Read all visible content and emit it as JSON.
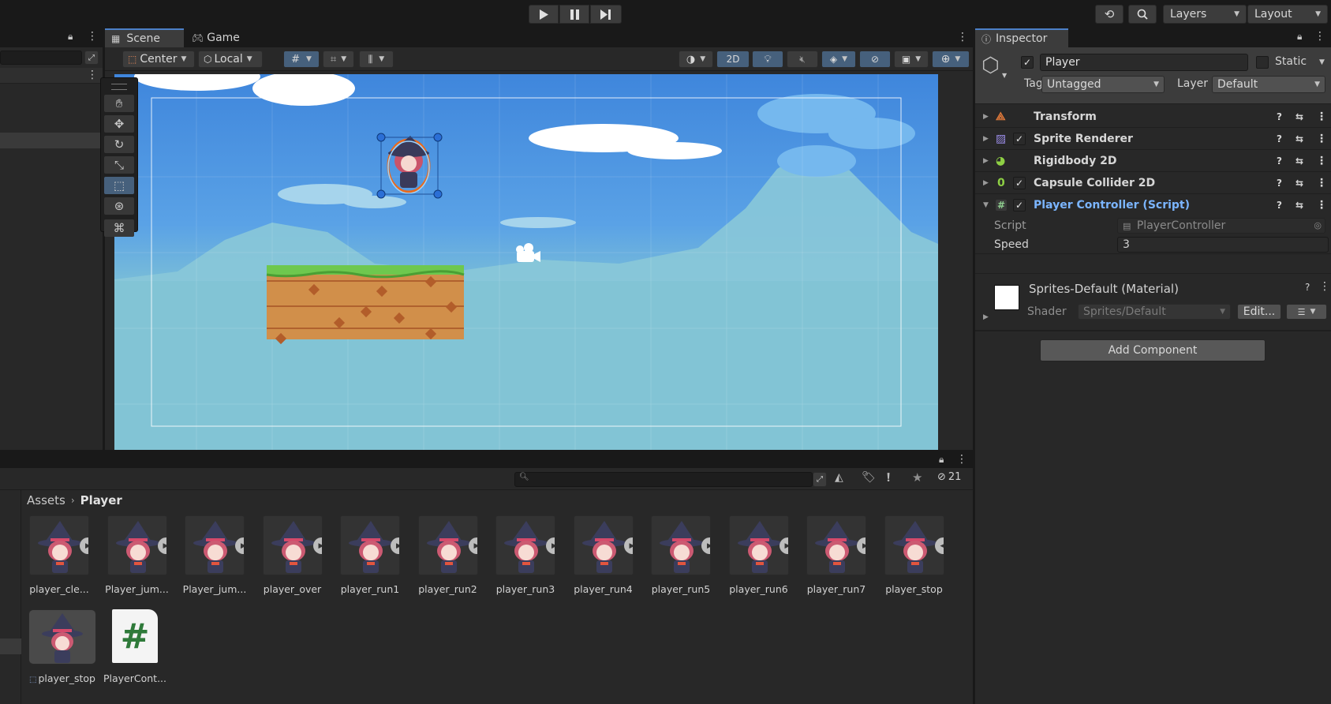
{
  "toolbar": {
    "layers_label": "Layers",
    "layout_label": "Layout"
  },
  "scene_tabs": [
    {
      "label": "Scene"
    },
    {
      "label": "Game"
    }
  ],
  "scene_toolbar": {
    "pivot_label": "Center",
    "space_label": "Local",
    "mode_2d_label": "2D"
  },
  "inspector": {
    "tab_label": "Inspector",
    "object_name": "Player",
    "static_label": "Static",
    "tag_label": "Tag",
    "tag_value": "Untagged",
    "layer_label": "Layer",
    "layer_value": "Default",
    "components": [
      {
        "name": "Transform",
        "has_checkbox": false
      },
      {
        "name": "Sprite Renderer",
        "has_checkbox": true
      },
      {
        "name": "Rigidbody 2D",
        "has_checkbox": false
      },
      {
        "name": "Capsule Collider 2D",
        "has_checkbox": true
      },
      {
        "name": "Player Controller (Script)",
        "has_checkbox": true
      }
    ],
    "script_label": "Script",
    "script_value": "PlayerController",
    "speed_label": "Speed",
    "speed_value": "3",
    "material_name": "Sprites-Default (Material)",
    "shader_label": "Shader",
    "shader_value": "Sprites/Default",
    "edit_label": "Edit...",
    "add_component_label": "Add Component"
  },
  "project": {
    "breadcrumb_root": "Assets",
    "breadcrumb_current": "Player",
    "hidden_count": "21",
    "assets_row1": [
      "player_cle...",
      "Player_jum...",
      "Player_jum...",
      "player_over",
      "player_run1",
      "player_run2",
      "player_run3",
      "player_run4",
      "player_run5",
      "player_run6",
      "player_run7",
      "player_stop"
    ],
    "assets_row2": [
      "player_stop",
      "PlayerCont..."
    ]
  },
  "colors": {
    "accent": "#46607c",
    "sky_top": "#3f86dc",
    "sky_bottom": "#7ec1d6",
    "script_link": "#7bb5ff"
  }
}
